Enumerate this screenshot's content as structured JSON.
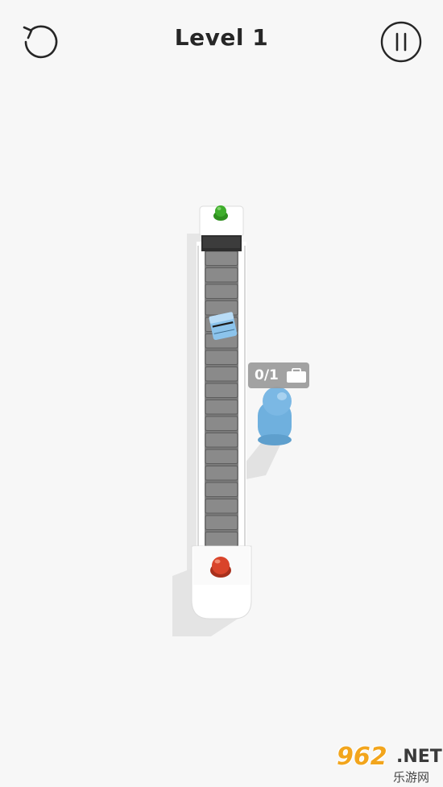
{
  "header": {
    "title": "Level 1",
    "restart_icon": "restart-icon",
    "pause_icon": "pause-icon"
  },
  "scene": {
    "counter": {
      "text": "0/1",
      "icon": "suitcase-icon",
      "delivered": 0,
      "required": 1
    },
    "colors": {
      "background": "#f7f7f7",
      "conveyor": "#7a7a7a",
      "frame": "#ffffff",
      "start_button": "#3fae2c",
      "stop_button": "#d9442a",
      "luggage": "#8cc4ec",
      "passenger": "#7bb8e4",
      "badge": "#9b9b9b"
    }
  },
  "watermark": {
    "brand": "962",
    "domain": ".NET",
    "sub": "乐游网"
  }
}
